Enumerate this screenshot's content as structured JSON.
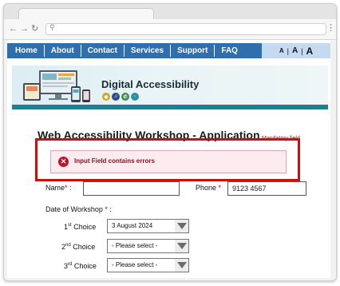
{
  "browser": {
    "icons": [
      "back-arrow-icon",
      "forward-arrow-icon",
      "reload-icon",
      "search-icon",
      "menu-dots-icon"
    ]
  },
  "nav": {
    "items": [
      "Home",
      "About",
      "Contact",
      "Services",
      "Support",
      "FAQ"
    ],
    "text_size": {
      "a1": "A",
      "sep1": "|",
      "a2": "A",
      "sep2": "|",
      "a3": "A"
    }
  },
  "banner": {
    "title": "Digital Accessibility",
    "icons": [
      "eye-icon",
      "audio-icon",
      "phone-icon",
      "ear-icon"
    ]
  },
  "form": {
    "title": "Web Accessibility Workshop - Application",
    "mandatory_note": "Mandatory field",
    "error": "Input Field contains errors",
    "name_label": "Name",
    "name_required": "*",
    "name_colon": ":",
    "name_value": "",
    "phone_label": "Phone",
    "phone_required": "*",
    "phone_value": "9123 4567",
    "date_label": "Date of Workshop",
    "date_required": "*",
    "date_colon": ":",
    "choices": [
      {
        "num": "1",
        "sup": "st",
        "label": " Choice",
        "value": "3 August 2024"
      },
      {
        "num": "2",
        "sup": "nd",
        "label": " Choice",
        "value": "- Please select -"
      },
      {
        "num": "3",
        "sup": "rd",
        "label": " Choice",
        "value": "- Please select -"
      }
    ]
  },
  "colors": {
    "nav": "#2f6fad",
    "error": "#cc1010",
    "required": "#d40000",
    "banner_stripe": "#1d7f90"
  }
}
